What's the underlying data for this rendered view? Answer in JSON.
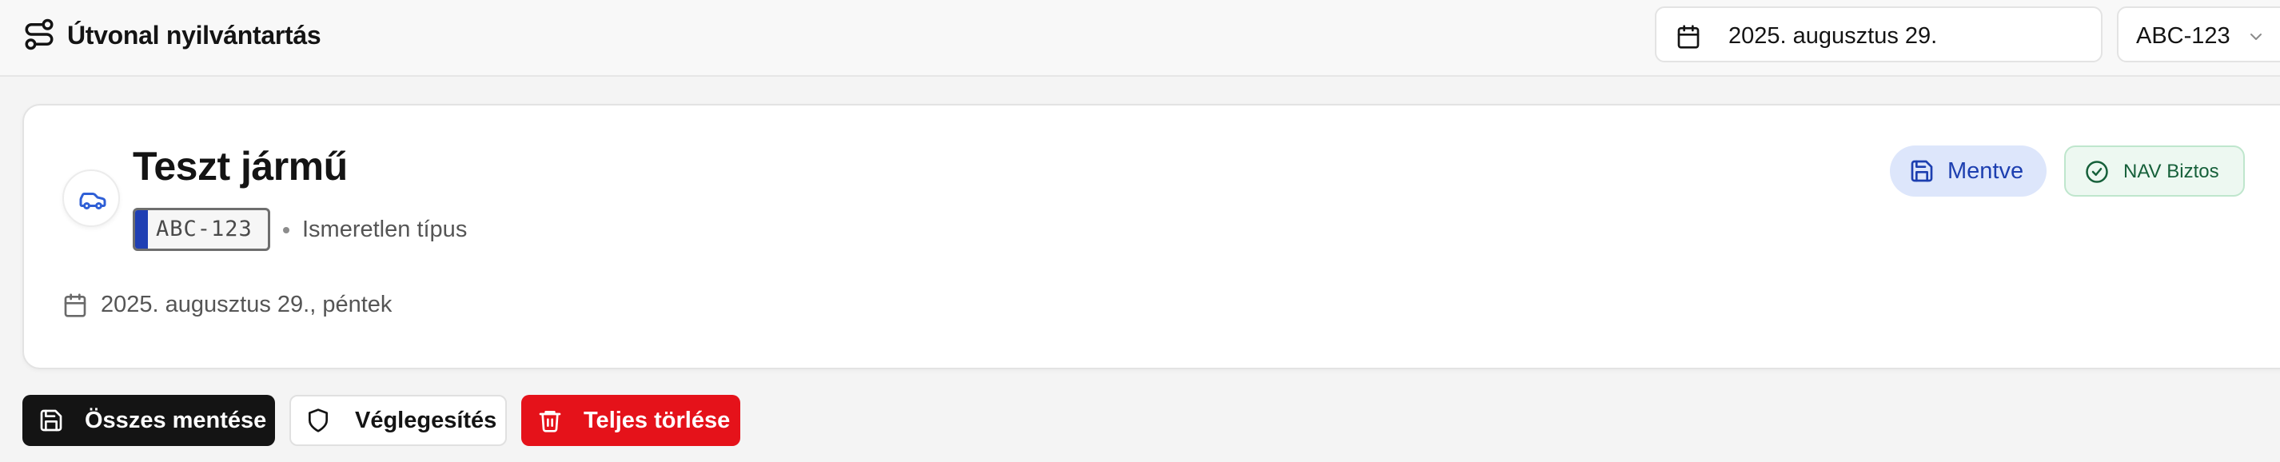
{
  "header": {
    "app_icon": "route-icon",
    "title": "Útvonal nyilvántartás",
    "date_icon": "calendar-icon",
    "date_value": "2025. augusztus 29.",
    "vehicle_select": {
      "value": "ABC-123",
      "icon": "chevron-down-icon"
    }
  },
  "vehicle_card": {
    "icon": "car-icon",
    "name": "Teszt jármű",
    "plate": "ABC-123",
    "plate_colors": {
      "eu_strip": "#1f3fb3",
      "border": "#6e6e6e"
    },
    "type": "Ismeretlen típus",
    "date_icon": "calendar-icon",
    "date_label": "2025. augusztus 29., péntek",
    "saved_badge": {
      "label": "Mentve",
      "icon": "save-icon",
      "color": "#1d3fb0",
      "background": "#dde6fb"
    },
    "nav_badge": {
      "label": "NAV Biztos",
      "icon": "check-circle-icon",
      "color": "#16603a",
      "background": "#edf8f1"
    }
  },
  "actions": {
    "save_all": {
      "label": "Összes mentése",
      "icon": "save-icon",
      "background": "#141414"
    },
    "finalize": {
      "label": "Véglegesítés",
      "icon": "shield-icon"
    },
    "delete_all": {
      "label": "Teljes törlése",
      "icon": "trash-icon",
      "background": "#e5121a"
    }
  }
}
